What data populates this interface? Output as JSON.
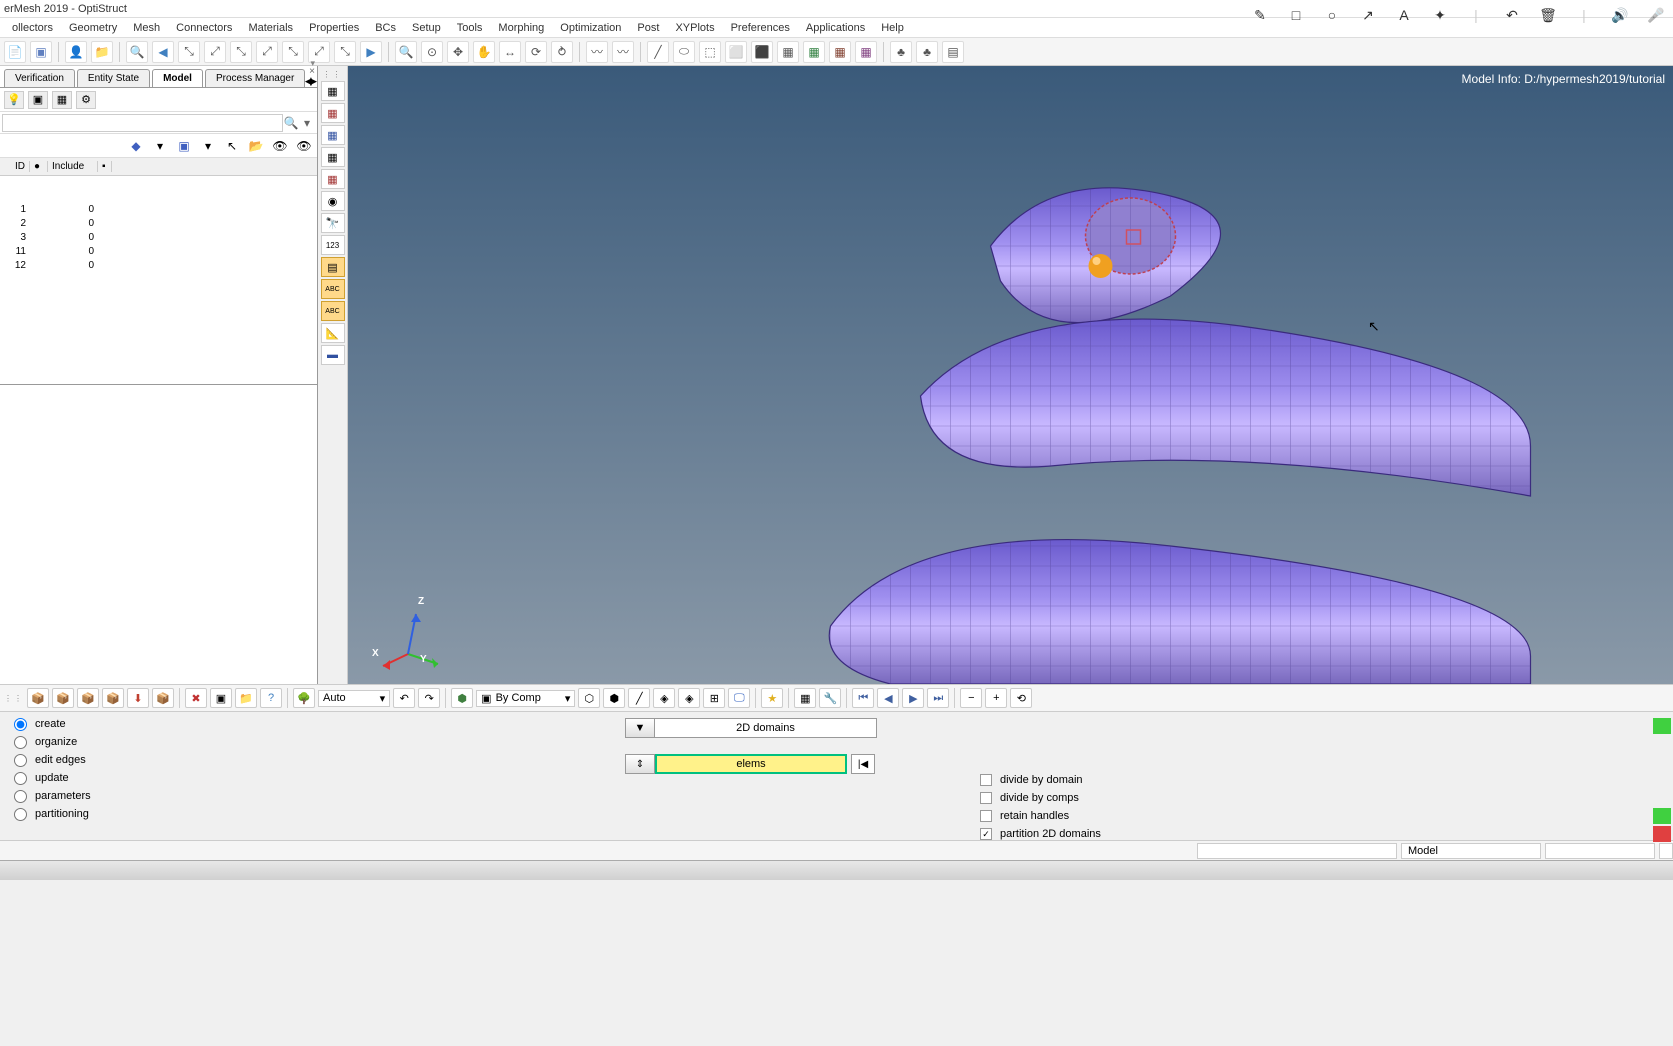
{
  "title": "erMesh 2019 - OptiStruct",
  "menu": [
    "ollectors",
    "Geometry",
    "Mesh",
    "Connectors",
    "Materials",
    "Properties",
    "BCs",
    "Setup",
    "Tools",
    "Morphing",
    "Optimization",
    "Post",
    "XYPlots",
    "Preferences",
    "Applications",
    "Help"
  ],
  "left_tabs": {
    "items": [
      "Verification",
      "Entity State",
      "Model",
      "Process Manager"
    ],
    "active_index": 2
  },
  "tree_header": {
    "id": "ID",
    "include": "Include"
  },
  "tree_rows": [
    {
      "id": "1",
      "include": "0"
    },
    {
      "id": "2",
      "include": "0"
    },
    {
      "id": "3",
      "include": "0"
    },
    {
      "id": "11",
      "include": "0"
    },
    {
      "id": "12",
      "include": "0"
    }
  ],
  "model_info": "Model Info: D:/hypermesh2019/tutorial",
  "axis": {
    "x": "X",
    "y": "Y",
    "z": "Z"
  },
  "bottom_toolbar": {
    "auto": "Auto",
    "bycomp": "By Comp"
  },
  "panel": {
    "radios": [
      "create",
      "organize",
      "edit edges",
      "update",
      "parameters",
      "partitioning"
    ],
    "selected_radio": 0,
    "domain_label": "2D domains",
    "elems_label": "elems",
    "checks": [
      {
        "label": "divide by domain",
        "checked": false
      },
      {
        "label": "divide by comps",
        "checked": false
      },
      {
        "label": "retain handles",
        "checked": false
      },
      {
        "label": "partition 2D domains",
        "checked": true
      }
    ]
  },
  "status": {
    "model": "Model"
  }
}
